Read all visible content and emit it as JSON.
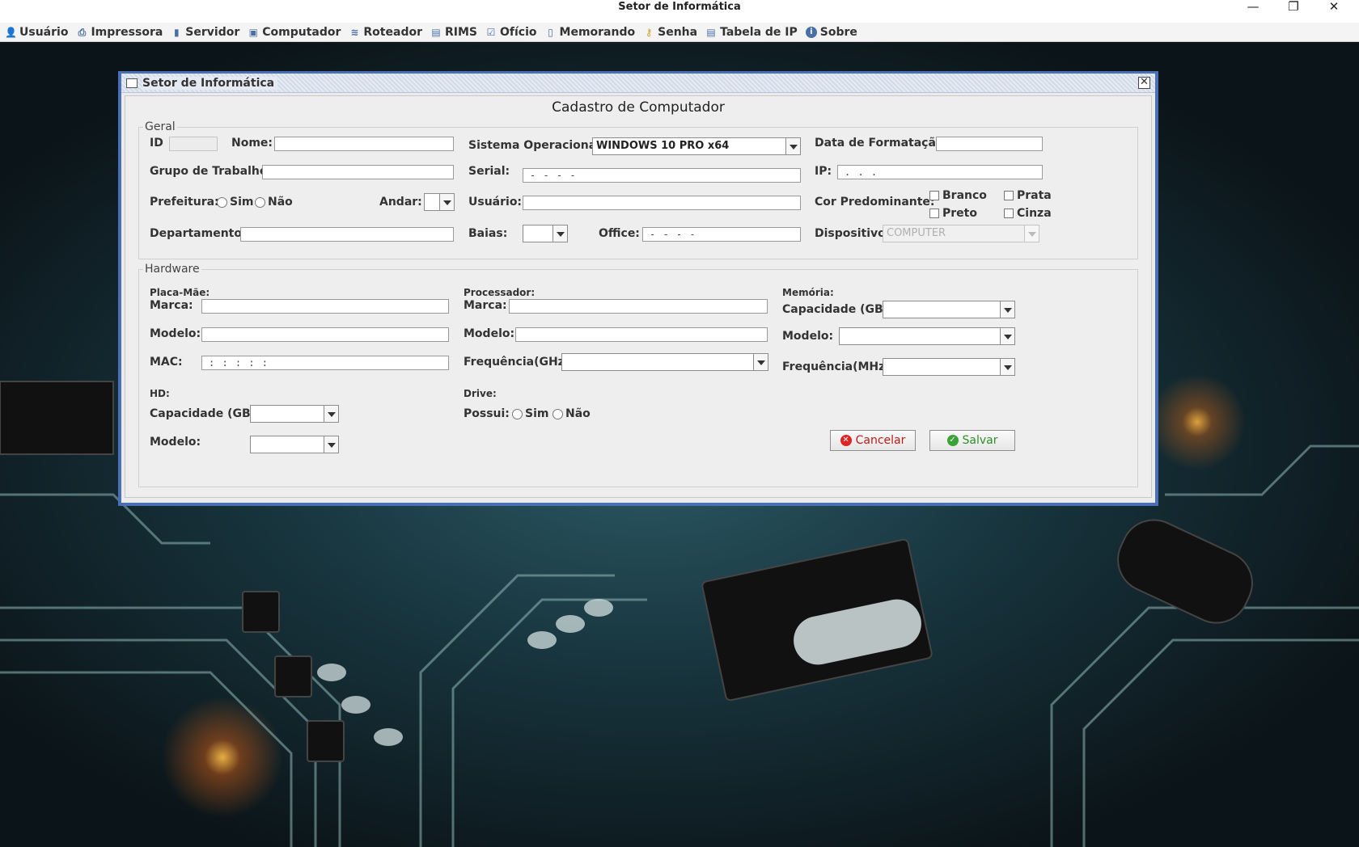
{
  "window": {
    "title": "Setor de Informática",
    "minimize": "—",
    "restore": "❐",
    "close": "✕"
  },
  "menubar": [
    {
      "label": "Usuário",
      "icon": "user-icon"
    },
    {
      "label": "Impressora",
      "icon": "printer-icon"
    },
    {
      "label": "Servidor",
      "icon": "server-icon"
    },
    {
      "label": "Computador",
      "icon": "computer-icon"
    },
    {
      "label": "Roteador",
      "icon": "router-icon"
    },
    {
      "label": "RIMS",
      "icon": "table-icon"
    },
    {
      "label": "Ofício",
      "icon": "document-check-icon"
    },
    {
      "label": "Memorando",
      "icon": "document-icon"
    },
    {
      "label": "Senha",
      "icon": "key-icon"
    },
    {
      "label": "Tabela de IP",
      "icon": "table-icon"
    },
    {
      "label": "Sobre",
      "icon": "info-icon"
    }
  ],
  "frame": {
    "title": "Setor de Informática",
    "heading": "Cadastro de Computador"
  },
  "geral": {
    "legend": "Geral",
    "id_label": "ID",
    "id_value": "",
    "nome_label": "Nome:",
    "nome_value": "",
    "so_label": "Sistema Operacional:",
    "so_value": "WINDOWS 10 PRO x64",
    "data_formatacao_label": "Data de Formatação:",
    "data_formatacao_value": "",
    "grupo_label": "Grupo de Trabalho:",
    "grupo_value": "",
    "serial_label": "Serial:",
    "serial_value": "     -     -     -     -",
    "ip_label": "IP:",
    "ip_value": "  .  .  .",
    "prefeitura_label": "Prefeitura:",
    "sim": "Sim",
    "nao": "Não",
    "andar_label": "Andar:",
    "andar_value": "",
    "usuario_label": "Usuário:",
    "usuario_value": "",
    "cor_label": "Cor Predominante:",
    "cor_branco": "Branco",
    "cor_prata": "Prata",
    "cor_preto": "Preto",
    "cor_cinza": "Cinza",
    "departamento_label": "Departamento:",
    "departamento_value": "",
    "baias_label": "Baias:",
    "baias_value": "",
    "office_label": "Office:",
    "office_value": "     -     -     -     -",
    "dispositivo_label": "Dispositivo",
    "dispositivo_value": "COMPUTER"
  },
  "hardware": {
    "legend": "Hardware",
    "placa_mae_label": "Placa-Mãe:",
    "marca_label": "Marca:",
    "modelo_label": "Modelo:",
    "mac_label": "MAC:",
    "mac_value": " : : : : :",
    "processador_label": "Processador:",
    "frequencia_ghz_label": "Frequência(GHz)",
    "memoria_label": "Memória:",
    "capacidade_label": "Capacidade (GB):",
    "frequencia_mhz_label": "Frequência(MHz)",
    "hd_label": "HD:",
    "drive_label": "Drive:",
    "possui_label": "Possui:",
    "sim": "Sim",
    "nao": "Não"
  },
  "buttons": {
    "cancelar": "Cancelar",
    "salvar": "Salvar"
  },
  "colors": {
    "frame_border": "#4a6fb5",
    "cancel_icon": "#e02424",
    "save_icon": "#3aa335",
    "cancel_text": "#c21818",
    "save_text": "#2f8f2a"
  }
}
